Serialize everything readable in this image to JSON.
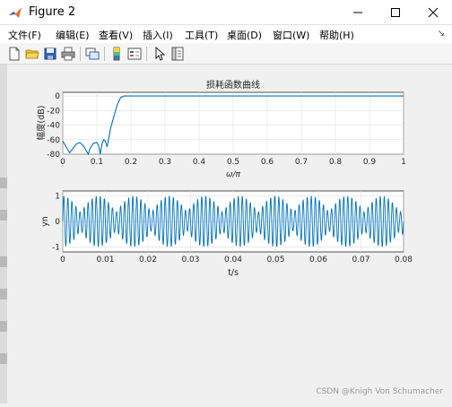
{
  "window": {
    "title": "Figure 2",
    "minimize_glyph": "—",
    "maximize_glyph": "☐",
    "close_glyph": "✕"
  },
  "menu": [
    {
      "label": "文件(F)"
    },
    {
      "label": "编辑(E)"
    },
    {
      "label": "查看(V)"
    },
    {
      "label": "插入(I)"
    },
    {
      "label": "工具(T)"
    },
    {
      "label": "桌面(D)"
    },
    {
      "label": "窗口(W)"
    },
    {
      "label": "帮助(H)"
    }
  ],
  "menu_arrow": "↘",
  "toolbar": [
    "new-figure-icon",
    "open-file-icon",
    "save-icon",
    "print-icon",
    "link-plot-icon",
    "colorbar-icon",
    "legend-icon",
    "pointer-icon",
    "property-inspector-icon"
  ],
  "colors": {
    "line": "#0072bd",
    "grid": "#dfdfdf",
    "axes_bg": "#ffffff",
    "figure_bg": "#f0f0f0"
  },
  "watermark": "CSDN @Knigh Von Schumacher",
  "chart_data": [
    {
      "type": "line",
      "title": "损耗函数曲线",
      "xlabel": "ω/π",
      "ylabel": "幅度(dB)",
      "xlim": [
        0,
        1
      ],
      "ylim": [
        -80,
        5
      ],
      "xticks": [
        "0",
        "0.1",
        "0.2",
        "0.3",
        "0.4",
        "0.5",
        "0.6",
        "0.7",
        "0.8",
        "0.9",
        "1"
      ],
      "yticks": [
        "0",
        "-20",
        "-40",
        "-60",
        "-80"
      ],
      "grid": true,
      "series": [
        {
          "x": [
            0,
            0.01,
            0.02,
            0.03,
            0.04,
            0.05,
            0.06,
            0.07,
            0.075,
            0.08,
            0.09,
            0.1,
            0.105,
            0.11,
            0.115,
            0.12,
            0.125,
            0.13,
            0.135,
            0.14,
            0.15,
            0.16,
            0.17,
            0.18,
            0.2,
            0.3,
            0.4,
            0.5,
            0.6,
            0.7,
            0.8,
            0.9,
            1.0
          ],
          "y": [
            -62,
            -70,
            -78,
            -72,
            -66,
            -64,
            -68,
            -76,
            -80,
            -72,
            -65,
            -64,
            -68,
            -80,
            -66,
            -60,
            -62,
            -70,
            -58,
            -45,
            -28,
            -12,
            -2,
            0,
            0,
            0,
            0,
            0,
            0,
            0,
            0,
            0,
            0
          ]
        }
      ]
    },
    {
      "type": "line",
      "title": "",
      "xlabel": "t/s",
      "ylabel": "yn",
      "xlim": [
        0,
        0.08
      ],
      "ylim": [
        -1.2,
        1.2
      ],
      "xticks": [
        "0",
        "0.01",
        "0.02",
        "0.03",
        "0.04",
        "0.05",
        "0.06",
        "0.07",
        "0.08"
      ],
      "yticks": [
        "1",
        "0",
        "-1"
      ],
      "grid": true,
      "series": [
        {
          "signal": "yn = amplitude-modulated oscillation",
          "carrier_hz": 1000,
          "envelope_period_s": 0.00833,
          "amplitude": 1.0,
          "duration_s": 0.08
        }
      ]
    }
  ]
}
